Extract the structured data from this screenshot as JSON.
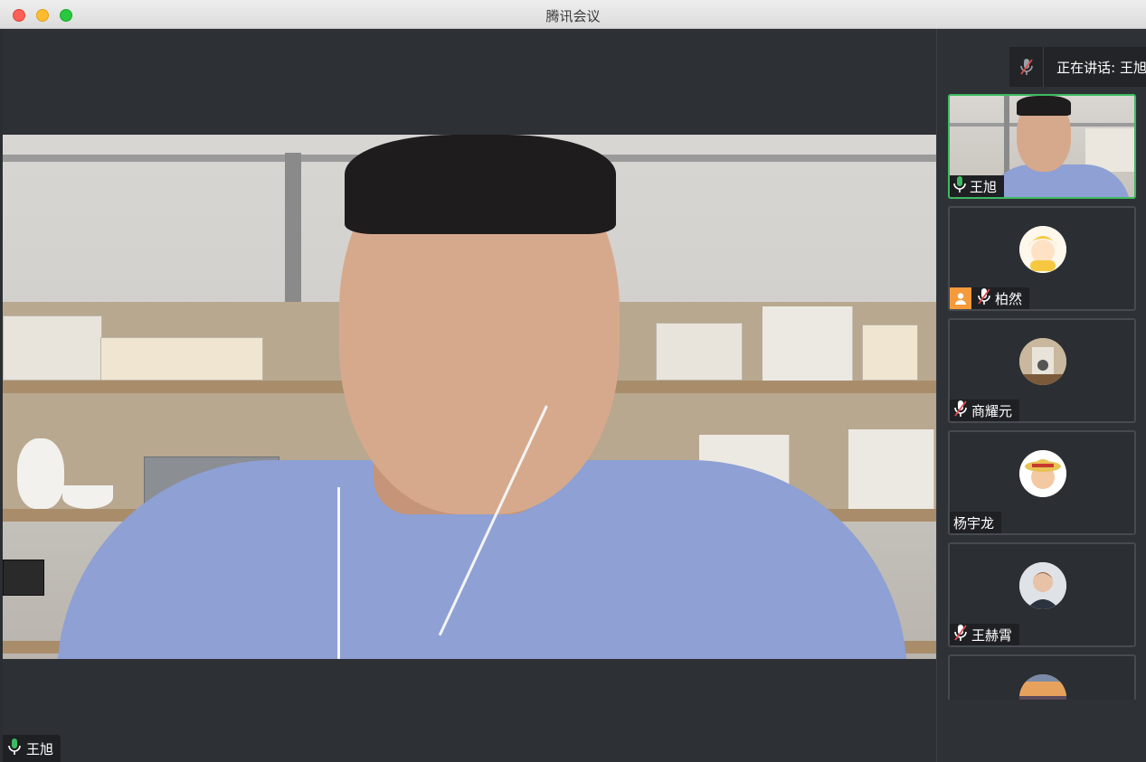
{
  "window": {
    "title": "腾讯会议"
  },
  "main": {
    "speaker_name": "王旭"
  },
  "sidebar": {
    "speaking_label": "正在讲话: 王旭",
    "participants": [
      {
        "name": "王旭",
        "mic": "on",
        "video": true,
        "active": true
      },
      {
        "name": "柏然",
        "mic": "muted",
        "host": true,
        "avatar": "cartoon-girl"
      },
      {
        "name": "商耀元",
        "mic": "muted",
        "avatar": "cat-window"
      },
      {
        "name": "杨宇龙",
        "mic": "none",
        "avatar": "straw-hat-cartoon"
      },
      {
        "name": "王赫霄",
        "mic": "muted",
        "avatar": "man-portrait"
      },
      {
        "name": "",
        "mic": "none",
        "avatar": "sunset-sky"
      }
    ]
  },
  "colors": {
    "active_border": "#3dbb60",
    "host_badge": "#f59a3a",
    "muted_mic": "#e04b4b",
    "live_mic": "#3dbb60"
  },
  "icons": {
    "mic_on": "mic-icon",
    "mic_muted": "mic-muted-icon",
    "host": "host-user-icon"
  }
}
